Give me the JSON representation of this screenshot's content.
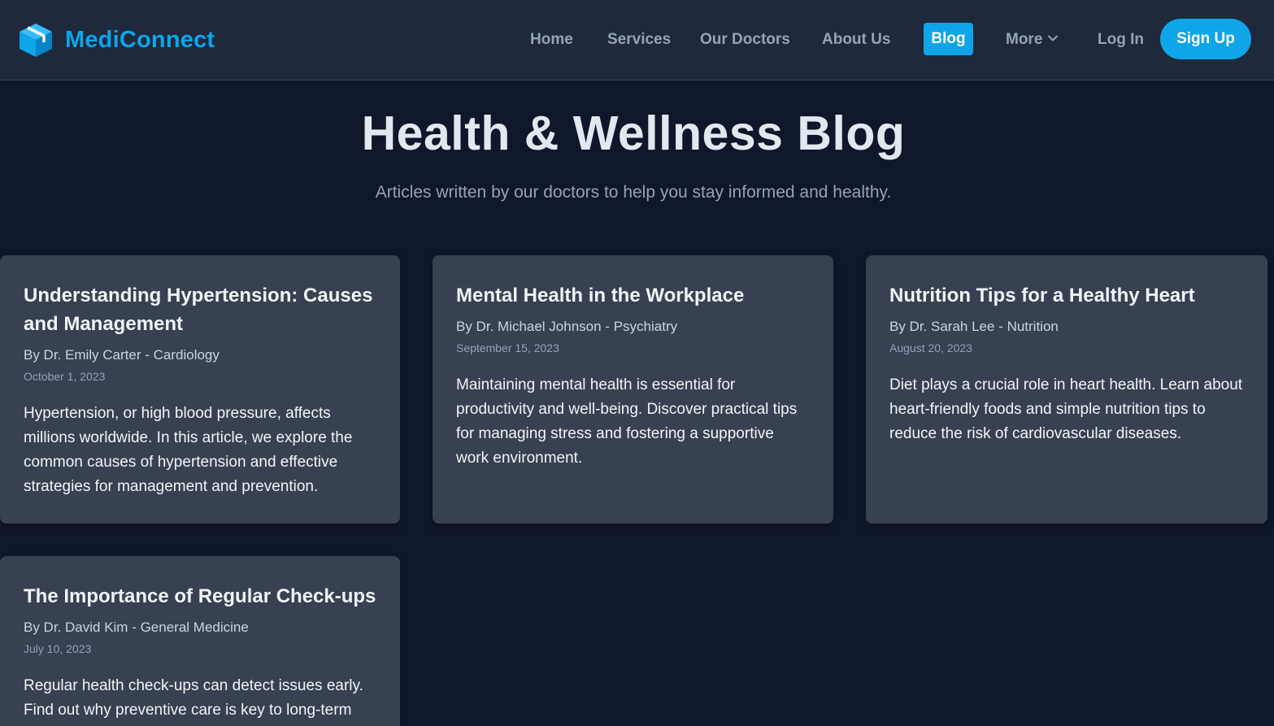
{
  "brand": {
    "name": "MediConnect",
    "logo_icon": "cube-icon",
    "accent_color": "#0ea5e9"
  },
  "nav": {
    "links": [
      {
        "label": "Home"
      },
      {
        "label": "Services"
      },
      {
        "label": "Our Doctors"
      },
      {
        "label": "About Us"
      }
    ],
    "active": {
      "label": "Blog"
    },
    "more": {
      "label": "More",
      "icon": "chevron-down-icon"
    },
    "login": {
      "label": "Log In"
    },
    "signup": {
      "label": "Sign Up"
    }
  },
  "hero": {
    "title": "Health & Wellness Blog",
    "subtitle": "Articles written by our doctors to help you stay informed and healthy."
  },
  "posts": [
    {
      "title": "Understanding Hypertension: Causes and Management",
      "author": "By Dr. Emily Carter - Cardiology",
      "date": "October 1, 2023",
      "excerpt": "Hypertension, or high blood pressure, affects millions worldwide. In this article, we explore the common causes of hypertension and effective strategies for management and prevention."
    },
    {
      "title": "Mental Health in the Workplace",
      "author": "By Dr. Michael Johnson - Psychiatry",
      "date": "September 15, 2023",
      "excerpt": "Maintaining mental health is essential for productivity and well-being. Discover practical tips for managing stress and fostering a supportive work environment."
    },
    {
      "title": "Nutrition Tips for a Healthy Heart",
      "author": "By Dr. Sarah Lee - Nutrition",
      "date": "August 20, 2023",
      "excerpt": "Diet plays a crucial role in heart health. Learn about heart-friendly foods and simple nutrition tips to reduce the risk of cardiovascular diseases."
    },
    {
      "title": "The Importance of Regular Check-ups",
      "author": "By Dr. David Kim - General Medicine",
      "date": "July 10, 2023",
      "excerpt": "Regular health check-ups can detect issues early. Find out why preventive care is key to long-term"
    }
  ]
}
